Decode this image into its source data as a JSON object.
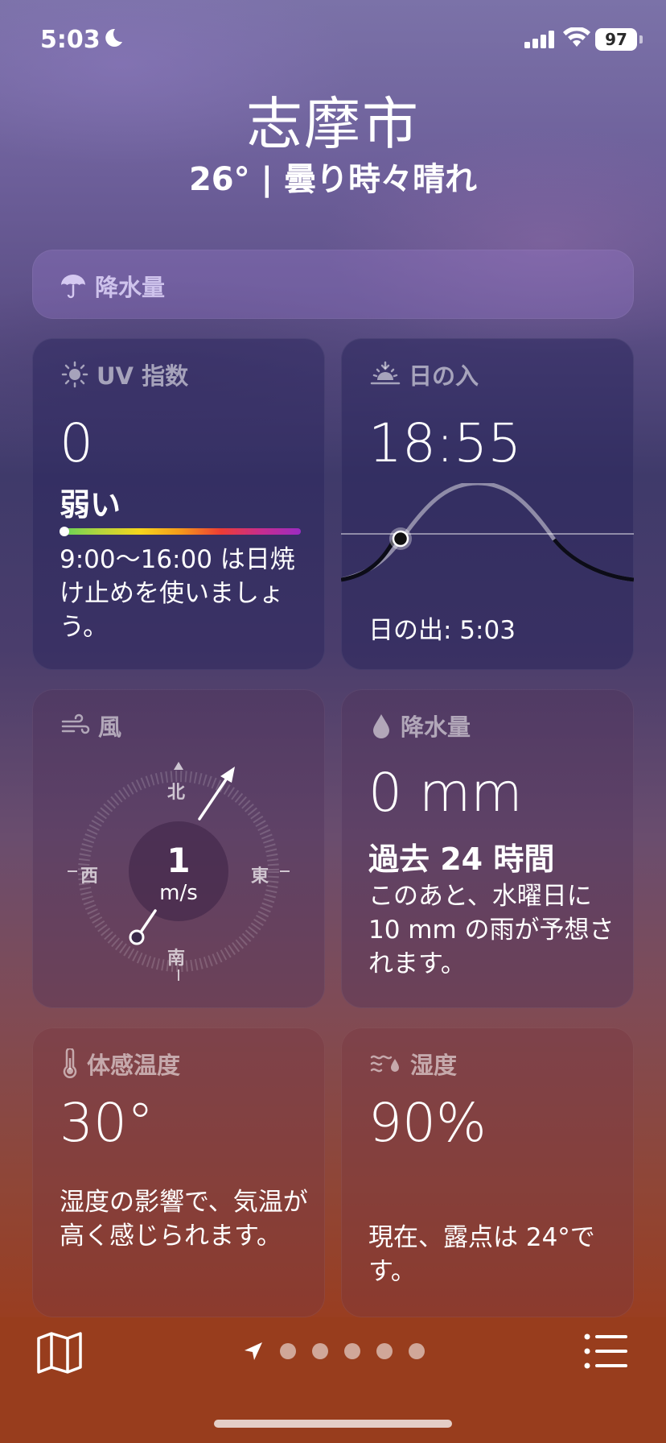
{
  "status": {
    "time": "5:03",
    "battery": "97"
  },
  "header": {
    "city": "志摩市",
    "summary": "26° | 曇り時々晴れ"
  },
  "banner": {
    "title": "降水量"
  },
  "uv": {
    "title": "UV 指数",
    "value": "0",
    "level": "弱い",
    "level_fraction": 0,
    "description": "9:00～16:00 は日焼け止めを使いましょう。"
  },
  "sunset": {
    "title": "日の入",
    "time": "18:55",
    "sunrise": "日の出: 5:03"
  },
  "wind": {
    "title": "風",
    "speed": "1",
    "unit": "m/s",
    "north": "北",
    "south": "南",
    "east": "東",
    "west": "西"
  },
  "precip": {
    "title": "降水量",
    "value": "0 mm",
    "period": "過去 24 時間",
    "description": "このあと、水曜日に 10 mm の雨が予想されます。"
  },
  "feels_like": {
    "title": "体感温度",
    "value": "30°",
    "description": "湿度の影響で、気温が高く感じられます。"
  },
  "humidity": {
    "title": "湿度",
    "value": "90%",
    "description": "現在、露点は 24°です。"
  },
  "tabbar": {
    "page_dots": 5
  }
}
